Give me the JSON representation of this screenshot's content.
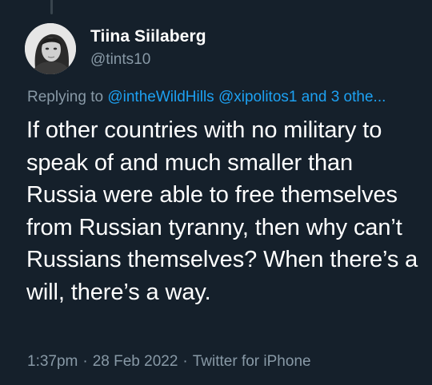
{
  "tweet": {
    "display_name": "Tiina Siilaberg",
    "handle": "@tints10",
    "reply": {
      "prefix": "Replying to",
      "mentions": [
        "@intheWildHills",
        "@xipolitos1",
        "and 3 othe..."
      ]
    },
    "text": "If other countries with no military to speak of and much smaller than Russia were able to free themselves from Russian tyranny, then why can’t Russians themselves? When there’s a will, there’s a way.",
    "time": "1:37pm",
    "separator": "·",
    "date": "28 Feb 2022",
    "client": "Twitter for iPhone"
  },
  "icons": {
    "avatar": "profile-photo"
  },
  "colors": {
    "background": "#15202b",
    "primary_text": "#ffffff",
    "secondary_text": "#8899a6",
    "link": "#1da1f2",
    "thread_line": "#38444d"
  }
}
